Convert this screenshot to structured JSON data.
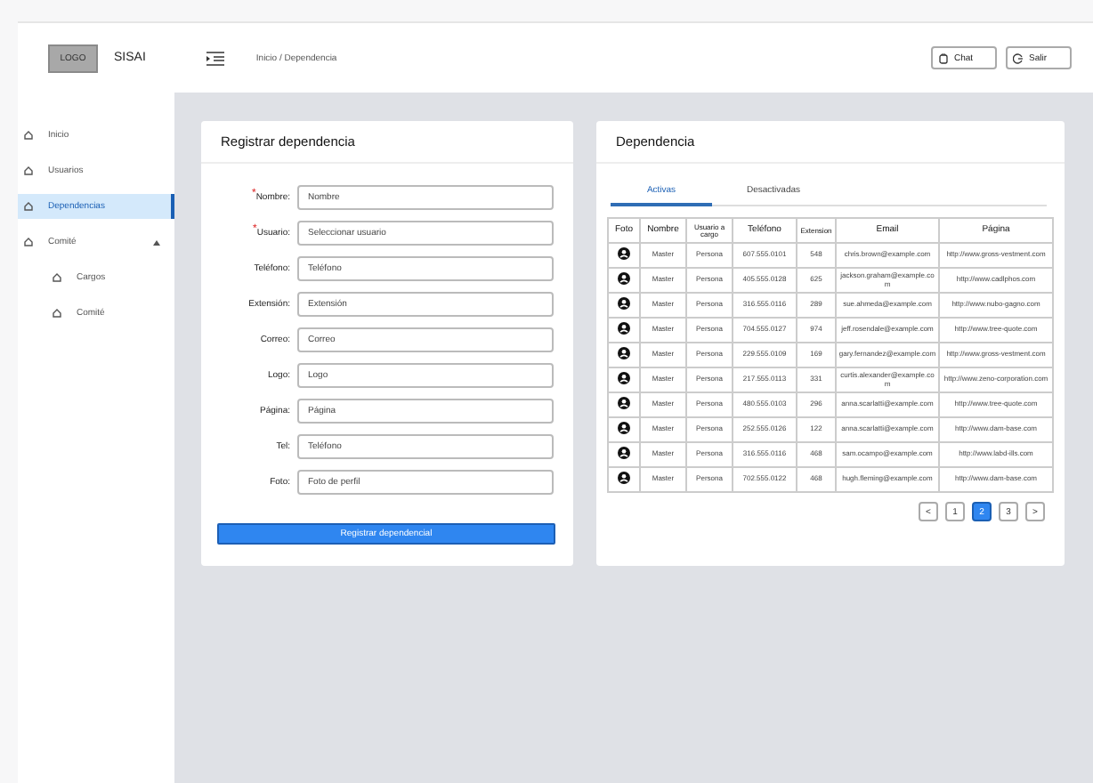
{
  "header": {
    "logo": "LOGO",
    "app_name": "SISAI",
    "breadcrumb": "Inicio / Dependencia",
    "buttons": [
      {
        "kind": "chat",
        "label": "Chat"
      },
      {
        "kind": "exit",
        "label": "Salir"
      }
    ]
  },
  "sidebar": {
    "items": [
      {
        "label": "Inicio",
        "selected": false
      },
      {
        "label": "Usuarios",
        "selected": false
      },
      {
        "label": "Dependencias",
        "selected": true
      },
      {
        "label": "Comité",
        "selected": false,
        "expanded": true,
        "children": [
          {
            "label": "Cargos",
            "selected": false
          },
          {
            "label": "Comité",
            "selected": false
          }
        ]
      }
    ]
  },
  "form": {
    "title": "Registrar dependencia",
    "required_mark": "*",
    "fields": [
      {
        "label": "Nombre:",
        "required": true,
        "placeholder": "Nombre"
      },
      {
        "label": "Usuario:",
        "required": true,
        "placeholder": "Seleccionar usuario"
      },
      {
        "label": "Teléfono:",
        "required": false,
        "placeholder": "Teléfono"
      },
      {
        "label": "Extensión:",
        "required": false,
        "placeholder": "Extensión"
      },
      {
        "label": "Correo:",
        "required": false,
        "placeholder": "Correo"
      },
      {
        "label": "Logo:",
        "required": false,
        "placeholder": "Logo"
      },
      {
        "label": "Página:",
        "required": false,
        "placeholder": "Página"
      },
      {
        "label": "Tel:",
        "required": false,
        "placeholder": "Teléfono"
      },
      {
        "label": "Foto:",
        "required": false,
        "placeholder": "Foto de perfil"
      }
    ],
    "submit": "Registrar dependencial"
  },
  "table_panel": {
    "title": "Dependencia",
    "tabs": [
      {
        "label": "Activas",
        "selected": true
      },
      {
        "label": "Desactivadas",
        "selected": false
      }
    ],
    "columns": [
      "Foto",
      "Nombre",
      "Usuario a cargo",
      "Teléfono",
      "Extension",
      "Email",
      "Página"
    ],
    "rows": [
      [
        "",
        "Master",
        "Persona",
        "607.555.0101",
        "548",
        "chris.brown@example.com",
        "http://www.gross-vestment.com"
      ],
      [
        "",
        "Master",
        "Persona",
        "405.555.0128",
        "625",
        "jackson.graham@example.com",
        "http://www.cadlphos.com"
      ],
      [
        "",
        "Master",
        "Persona",
        "316.555.0116",
        "289",
        "sue.ahmeda@example.com",
        "http://www.nubo-gagno.com"
      ],
      [
        "",
        "Master",
        "Persona",
        "704.555.0127",
        "974",
        "jeff.rosendale@example.com",
        "http://www.tree-quote.com"
      ],
      [
        "",
        "Master",
        "Persona",
        "229.555.0109",
        "169",
        "gary.fernandez@example.com",
        "http://www.gross-vestment.com"
      ],
      [
        "",
        "Master",
        "Persona",
        "217.555.0113",
        "331",
        "curtis.alexander@example.com",
        "http://www.zeno-corporation.com"
      ],
      [
        "",
        "Master",
        "Persona",
        "480.555.0103",
        "296",
        "anna.scarlatti@example.com",
        "http://www.tree-quote.com"
      ],
      [
        "",
        "Master",
        "Persona",
        "252.555.0126",
        "122",
        "anna.scarlatti@example.com",
        "http://www.dam-base.com"
      ],
      [
        "",
        "Master",
        "Persona",
        "316.555.0116",
        "468",
        "sam.ocampo@example.com",
        "http://www.labd-ills.com"
      ],
      [
        "",
        "Master",
        "Persona",
        "702.555.0122",
        "468",
        "hugh.fleming@example.com",
        "http://www.dam-base.com"
      ]
    ],
    "pagination": {
      "prev": "<",
      "next": ">",
      "pages": [
        {
          "label": "1",
          "selected": false
        },
        {
          "label": "2",
          "selected": true
        },
        {
          "label": "3",
          "selected": false
        }
      ]
    }
  }
}
